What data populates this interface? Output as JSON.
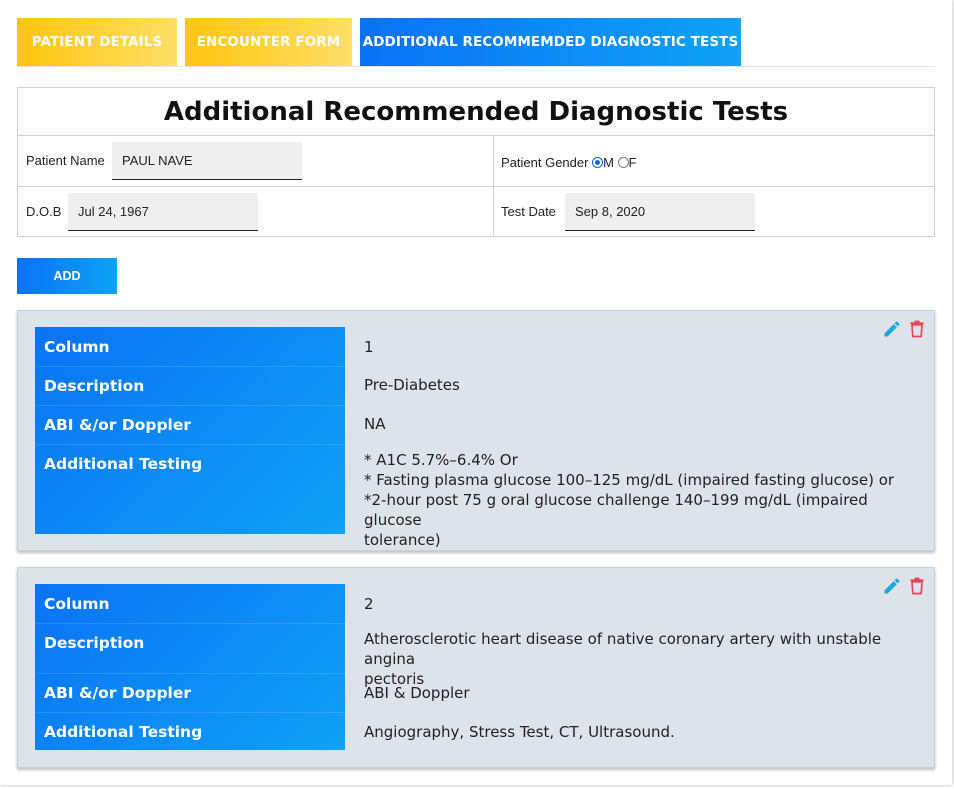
{
  "tabs": [
    {
      "label": "PATIENT DETAILS"
    },
    {
      "label": "ENCOUNTER FORM"
    },
    {
      "label": "ADDITIONAL RECOMMEMDED DIAGNOSTIC TESTS"
    }
  ],
  "form": {
    "title": "Additional Recommended Diagnostic Tests",
    "patient_name_label": "Patient Name",
    "patient_name_value": "PAUL NAVE",
    "gender_label": "Patient Gender",
    "gender_options": [
      {
        "label": "M",
        "selected": true
      },
      {
        "label": "F",
        "selected": false
      }
    ],
    "dob_label": "D.O.B",
    "dob_value": "Jul 24, 1967",
    "test_date_label": "Test Date",
    "test_date_value": "Sep 8, 2020"
  },
  "add_label": "ADD",
  "row_labels": {
    "column": "Column",
    "description": "Description",
    "abi": "ABI &/or Doppler",
    "additional": "Additional Testing"
  },
  "cards": [
    {
      "column": "1",
      "description": "Pre-Diabetes",
      "abi": "NA",
      "additional_lines": [
        "* A1C 5.7%–6.4% Or",
        "* Fasting plasma glucose 100–125 mg/dL (impaired fasting glucose) or",
        "*2-hour post 75 g oral glucose challenge 140–199 mg/dL (impaired glucose",
        "tolerance)"
      ]
    },
    {
      "column": "2",
      "description_lines": [
        "Atherosclerotic heart disease of native coronary artery with unstable angina",
        "pectoris"
      ],
      "abi": "ABI & Doppler",
      "additional": "Angiography, Stress Test, CT, Ultrasound."
    }
  ],
  "icons": {
    "edit": "pencil-icon",
    "delete": "trash-icon"
  },
  "colors": {
    "accent_blue": "#0a72f5",
    "accent_yellow": "#ffc50f",
    "edit": "#1aa6e0",
    "delete": "#e8435a"
  }
}
